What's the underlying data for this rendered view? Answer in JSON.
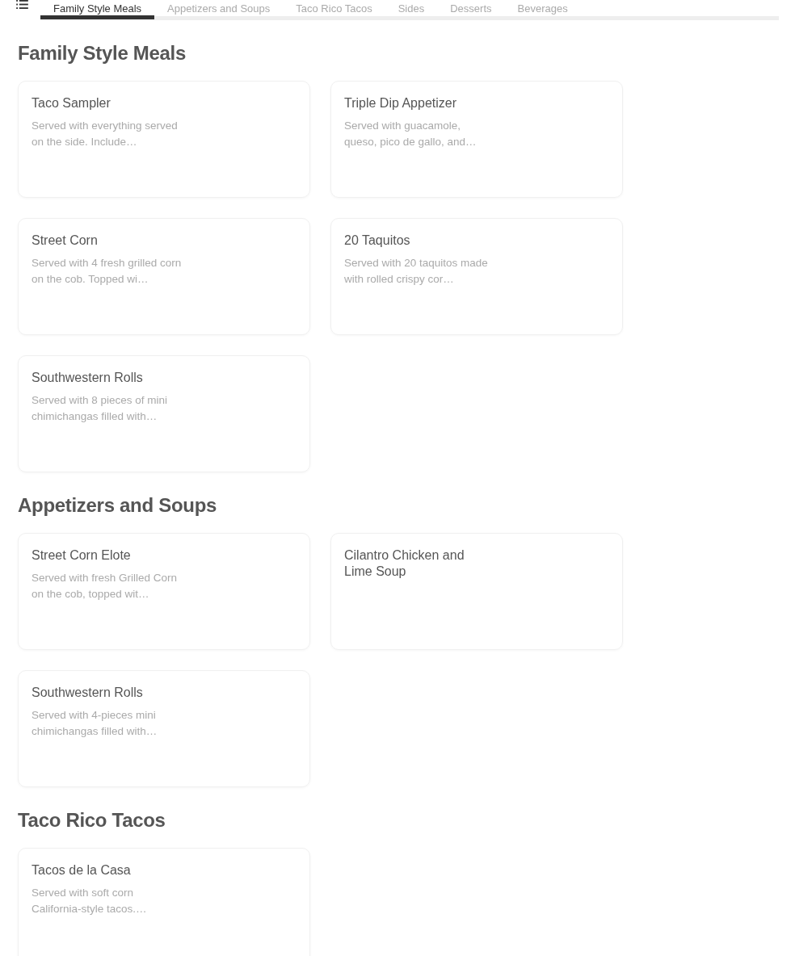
{
  "tabs": [
    {
      "label": "Family Style Meals",
      "selected": true
    },
    {
      "label": "Appetizers and Soups",
      "selected": false
    },
    {
      "label": "Taco Rico Tacos",
      "selected": false
    },
    {
      "label": "Sides",
      "selected": false
    },
    {
      "label": "Desserts",
      "selected": false
    },
    {
      "label": "Beverages",
      "selected": false
    }
  ],
  "sections": [
    {
      "title": "Family Style Meals",
      "items": [
        {
          "name": "Taco Sampler",
          "description": "Served with everything served on the side. Include…"
        },
        {
          "name": "Triple Dip Appetizer",
          "description": "Served with guacamole, queso, pico de gallo, and…"
        },
        {
          "name": "Street Corn",
          "description": "Served with 4 fresh grilled corn on the cob. Topped wi…"
        },
        {
          "name": "20 Taquitos",
          "description": "Served with 20 taquitos made with rolled crispy cor…"
        },
        {
          "name": "Southwestern Rolls",
          "description": "Served with 8 pieces of mini chimichangas filled with…"
        }
      ]
    },
    {
      "title": "Appetizers and Soups",
      "items": [
        {
          "name": "Street Corn Elote",
          "description": "Served with fresh Grilled Corn on the cob, topped wit…"
        },
        {
          "name": "Cilantro Chicken and Lime Soup"
        },
        {
          "name": "Southwestern Rolls",
          "description": "Served with 4-pieces mini chimichangas filled with…"
        }
      ]
    },
    {
      "title": "Taco Rico Tacos",
      "items": [
        {
          "name": "Tacos de la Casa",
          "description": "Served with soft corn California-style tacos.…"
        }
      ]
    }
  ]
}
